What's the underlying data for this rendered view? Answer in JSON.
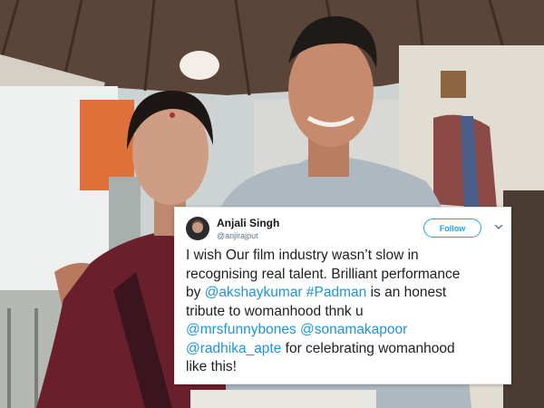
{
  "tweet": {
    "user_name": "Anjali Singh",
    "user_handle": "@anjirajput",
    "follow_label": "Follow",
    "lines": [
      [
        {
          "text": "I wish Our film industry wasn’t slow in",
          "link": false
        }
      ],
      [
        {
          "text": "recognising real talent. Brilliant performance",
          "link": false
        }
      ],
      [
        {
          "text": "by ",
          "link": false
        },
        {
          "text": "@akshaykumar",
          "link": true
        },
        {
          "text": " ",
          "link": false
        },
        {
          "text": "#Padman",
          "link": true
        },
        {
          "text": " is an honest",
          "link": false
        }
      ],
      [
        {
          "text": "tribute to womanhood thnk u",
          "link": false
        }
      ],
      [
        {
          "text": "@mrsfunnybones",
          "link": true
        },
        {
          "text": " ",
          "link": false
        },
        {
          "text": "@sonamakapoor",
          "link": true
        }
      ],
      [
        {
          "text": "@radhika_apte",
          "link": true
        },
        {
          "text": " for celebrating womanhood",
          "link": false
        }
      ],
      [
        {
          "text": "like this!",
          "link": false
        }
      ]
    ]
  },
  "colors": {
    "link": "#1b95e0",
    "follow_accent": "#1da1f2",
    "text": "#1c2022",
    "handle": "#657786"
  },
  "icons": {
    "menu": "chevron-down-icon",
    "avatar": "avatar"
  }
}
